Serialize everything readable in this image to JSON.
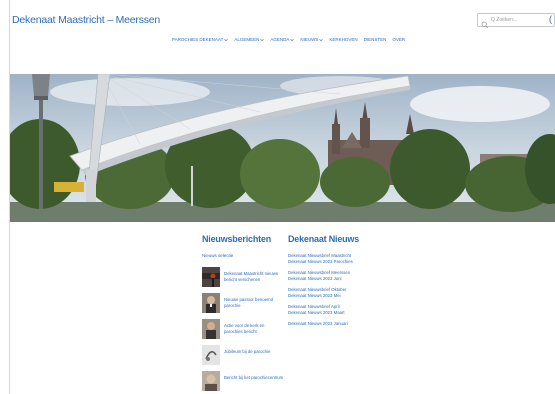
{
  "site": {
    "title": "Dekenaat Maastricht – Meerssen",
    "accent_color": "#2f6db5",
    "edge_glyph": "("
  },
  "search": {
    "placeholder": "Q Zoeken...",
    "icon": "search-icon"
  },
  "nav": {
    "items": [
      {
        "label": "PAROCHIES DEKENAAT",
        "has_dropdown": true
      },
      {
        "label": "ALGEMEEN",
        "has_dropdown": true
      },
      {
        "label": "AGENDA",
        "has_dropdown": true
      },
      {
        "label": "NIEUWS",
        "has_dropdown": true
      },
      {
        "label": "KERKHOVEN",
        "has_dropdown": false
      },
      {
        "label": "DIENSTEN",
        "has_dropdown": false
      },
      {
        "label": "OVER",
        "has_dropdown": false
      }
    ]
  },
  "nieuws": {
    "heading": "Nieuwsberichten",
    "sub_label": "Nieuws selectie",
    "items": [
      {
        "text": "Dekenaat Maastricht nieuws bericht verschenen"
      },
      {
        "text": "Nieuwe pastoor benoemd parochie"
      },
      {
        "text": "Actie voor de kerk en parochies bericht"
      },
      {
        "text": "Jubileum bij de parochie"
      },
      {
        "text": "Bericht bij het parochiecentrum"
      }
    ]
  },
  "dekenaat": {
    "heading": "Dekenaat Nieuws",
    "groups": [
      {
        "lines": [
          "Dekenaat Nieuwsbrief Maastricht",
          "Dekenaat Nieuws 2023 Parochies"
        ]
      },
      {
        "lines": [
          "Dekenaat Nieuwsbrief Meerssen",
          "Dekenaat Nieuws 2023 Juni"
        ]
      },
      {
        "lines": [
          "Dekenaat Nieuwsbrief Oktober",
          "Dekenaat Nieuws 2023 Mei"
        ]
      },
      {
        "lines": [
          "Dekenaat Nieuwsbrief April",
          "Dekenaat Nieuws 2023 Maart"
        ]
      },
      {
        "lines": [
          "Dekenaat Nieuws 2023 Januari"
        ]
      }
    ]
  }
}
